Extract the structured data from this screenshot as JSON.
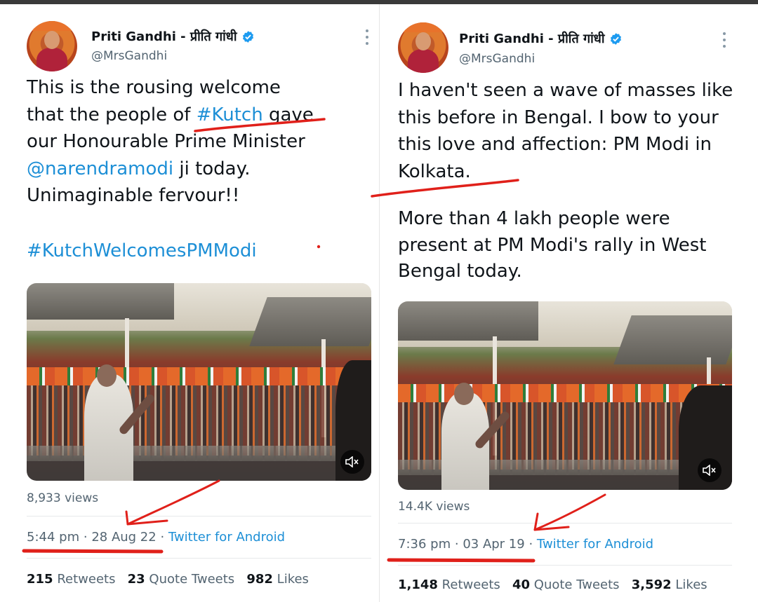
{
  "left_tweet": {
    "display_name": "Priti Gandhi - प्रीति गांधी",
    "handle": "@MrsGandhi",
    "text_line1": "This is the rousing welcome",
    "text_line2_pre": "that the people of ",
    "text_line2_tag": "#Kutch",
    "text_line2_post": " gave",
    "text_line3": "our Honourable Prime Minister",
    "text_line4_mention": "@narendramodi",
    "text_line4_post": " ji today.",
    "text_line5": "Unimaginable fervour!!",
    "hashtag": "#KutchWelcomesPMModi",
    "views": "8,933 views",
    "time": "5:44 pm",
    "sep": "·",
    "date": "28 Aug 22",
    "source": "Twitter for Android",
    "retweets_count": "215",
    "retweets_label": "Retweets",
    "quotes_count": "23",
    "quotes_label": "Quote Tweets",
    "likes_count": "982",
    "likes_label": "Likes"
  },
  "right_tweet": {
    "display_name": "Priti Gandhi - प्रीति गांधी",
    "handle": "@MrsGandhi",
    "text_line1": "I haven't seen a wave of masses like",
    "text_line2": "this before in Bengal. I bow to your",
    "text_line3": "this love and affection: PM Modi in",
    "text_line4": "Kolkata.",
    "text_line5": "More than 4 lakh people were",
    "text_line6": "present at PM Modi's rally in West",
    "text_line7": "Bengal today.",
    "views": "14.4K views",
    "time": "7:36 pm",
    "sep": "·",
    "date": "03 Apr 19",
    "source": "Twitter for Android",
    "retweets_count": "1,148",
    "retweets_label": "Retweets",
    "quotes_count": "40",
    "quotes_label": "Quote Tweets",
    "likes_count": "3,592",
    "likes_label": "Likes"
  },
  "colors": {
    "link": "#1d8fd6",
    "annotation": "#e0201a",
    "verified": "#1d9bf0",
    "muted_text": "#536471"
  },
  "icons": [
    "verified-badge-icon",
    "more-options-icon",
    "mute-icon"
  ]
}
